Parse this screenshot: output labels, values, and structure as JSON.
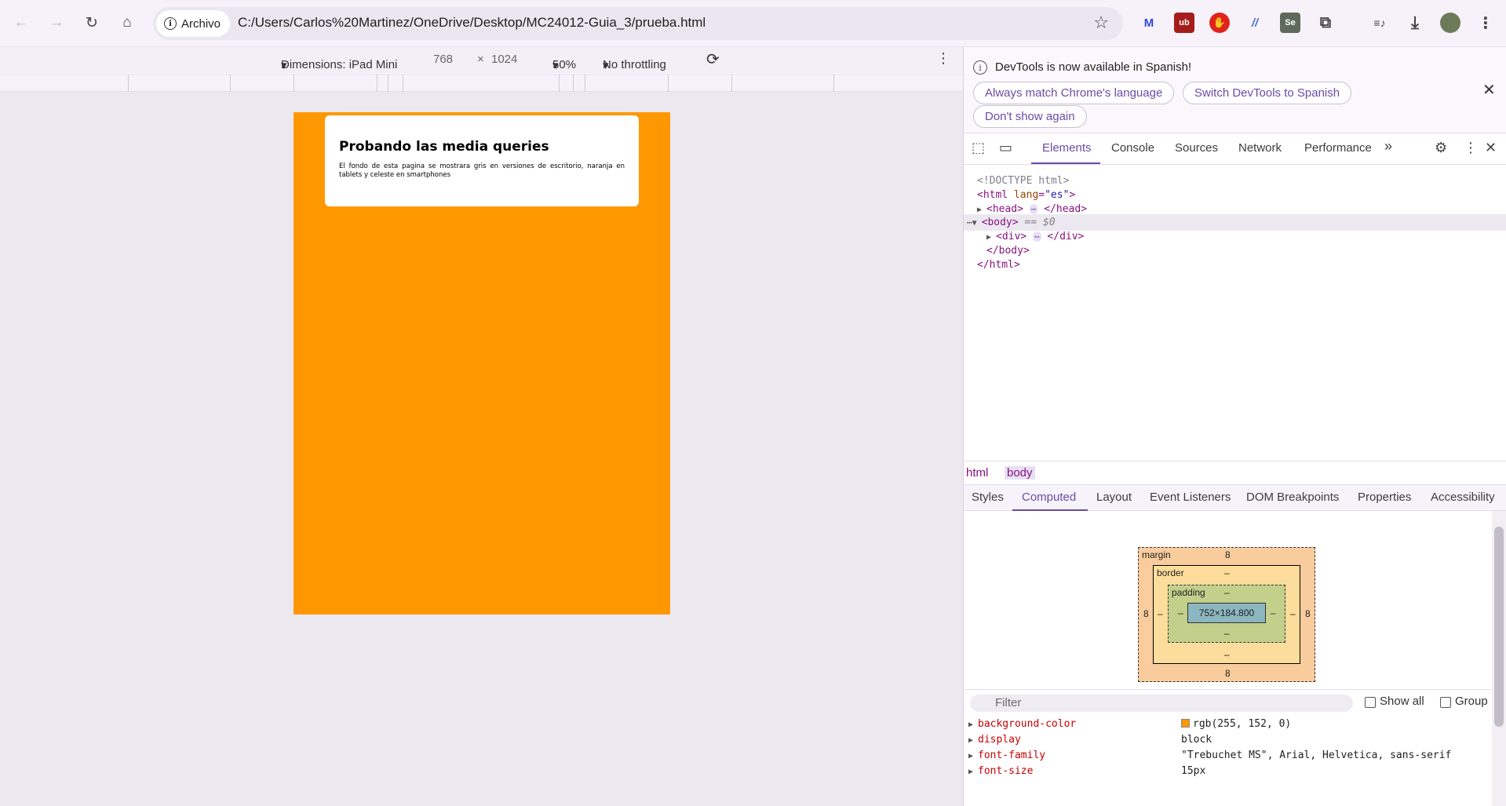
{
  "browser": {
    "chip_label": "Archivo",
    "url": "C:/Users/Carlos%20Martinez/OneDrive/Desktop/MC24012-Guia_3/prueba.html",
    "back_icon": "←",
    "forward_icon": "→",
    "reload_icon": "↻",
    "home_icon": "⌂",
    "star_icon": "☆",
    "extensions": [
      {
        "name": "malwarebytes",
        "glyph": "M",
        "color": "#2f4bd4"
      },
      {
        "name": "ublock",
        "glyph": "ub",
        "color": "#b3201c"
      },
      {
        "name": "adblock",
        "glyph": "✋",
        "color": "#e0241b"
      },
      {
        "name": "analytics",
        "glyph": "//",
        "color": "#4a6fd6"
      },
      {
        "name": "selenium",
        "glyph": "Se",
        "color": "#43b02a"
      },
      {
        "name": "puzzle",
        "glyph": "⧉",
        "color": "#444"
      }
    ],
    "media_icon": "≡♪",
    "download_icon": "⤓",
    "menu_icon": "⋮"
  },
  "device_toolbar": {
    "dimensions": "Dimensions: iPad Mini",
    "width": "768",
    "times": "×",
    "height": "1024",
    "zoom": "50%",
    "throttling": "No throttling"
  },
  "page": {
    "heading": "Probando las media queries",
    "text": "El fondo de esta pagina se mostrara gris en versiones de escritorio, naranja en tablets y celeste en smartphones",
    "background_color": "#ff9800"
  },
  "devtools": {
    "notice": "DevTools is now available in Spanish!",
    "btn_match": "Always match Chrome's language",
    "btn_switch": "Switch DevTools to Spanish",
    "btn_dont_show": "Don't show again",
    "tabs": [
      "Elements",
      "Console",
      "Sources",
      "Network",
      "Performance"
    ],
    "more_tabs": "»",
    "dom": {
      "doctype": "<!DOCTYPE html>",
      "html_open_tag": "<html ",
      "html_attr": "lang",
      "html_attr_value": "\"es\"",
      "html_open_close": ">",
      "head_open": "<head>",
      "head_close": "</head>",
      "body_open": "<body>",
      "body_eq": " == $0",
      "div_open": "<div>",
      "div_close": "</div>",
      "body_close": "</body>",
      "html_close": "</html>",
      "ellipsis": "⋯"
    },
    "breadcrumbs": [
      "html",
      "body"
    ],
    "subtabs": [
      "Styles",
      "Computed",
      "Layout",
      "Event Listeners",
      "DOM Breakpoints",
      "Properties",
      "Accessibility"
    ],
    "box_model": {
      "margin_label": "margin",
      "margin_top": "8",
      "margin_bottom": "8",
      "margin_left": "8",
      "margin_right": "8",
      "border_label": "border",
      "border_value": "–",
      "padding_label": "padding",
      "padding_value": "–",
      "content": "752×184.800"
    },
    "filter_placeholder": "Filter",
    "show_all": "Show all",
    "group": "Group",
    "properties": [
      {
        "name": "background-color",
        "value": "rgb(255, 152, 0)"
      },
      {
        "name": "display",
        "value": "block"
      },
      {
        "name": "font-family",
        "value": "\"Trebuchet MS\", Arial, Helvetica, sans-serif"
      },
      {
        "name": "font-size",
        "value": "15px"
      }
    ]
  }
}
